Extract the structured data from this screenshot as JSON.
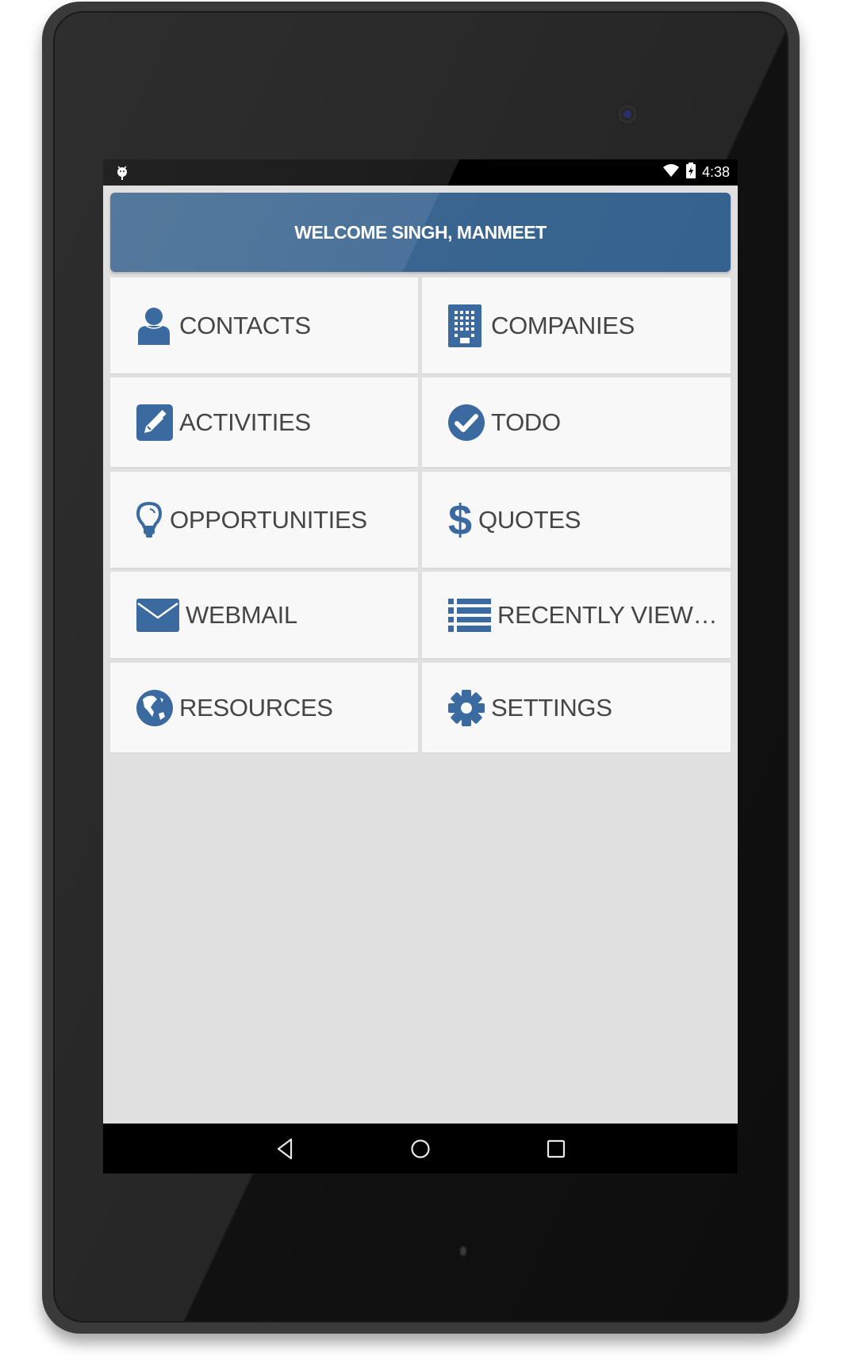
{
  "status_bar": {
    "notification_icon": "android-debug-icon",
    "wifi_icon": "wifi-icon",
    "battery_icon": "battery-charging-icon",
    "time": "4:38"
  },
  "header": {
    "title": "WELCOME SINGH, MANMEET"
  },
  "tiles": [
    {
      "label": "CONTACTS",
      "icon": "person-icon"
    },
    {
      "label": "COMPANIES",
      "icon": "building-icon"
    },
    {
      "label": "ACTIVITIES",
      "icon": "pencil-icon"
    },
    {
      "label": "TODO",
      "icon": "check-circle-icon"
    },
    {
      "label": "OPPORTUNITIES",
      "icon": "lightbulb-icon"
    },
    {
      "label": "QUOTES",
      "icon": "dollar-icon"
    },
    {
      "label": "WEBMAIL",
      "icon": "envelope-icon"
    },
    {
      "label": "RECENTLY VIEW…",
      "icon": "list-icon"
    },
    {
      "label": "RESOURCES",
      "icon": "globe-icon"
    },
    {
      "label": "SETTINGS",
      "icon": "gear-icon"
    }
  ],
  "nav_bar": {
    "back": "back-icon",
    "home": "home-icon",
    "recents": "recents-icon"
  },
  "colors": {
    "accent": "#3a6a9f",
    "header": "#3f6a95",
    "tile_bg": "#f8f8f8",
    "screen_bg": "#e0e0e0",
    "label_text": "#454545"
  }
}
